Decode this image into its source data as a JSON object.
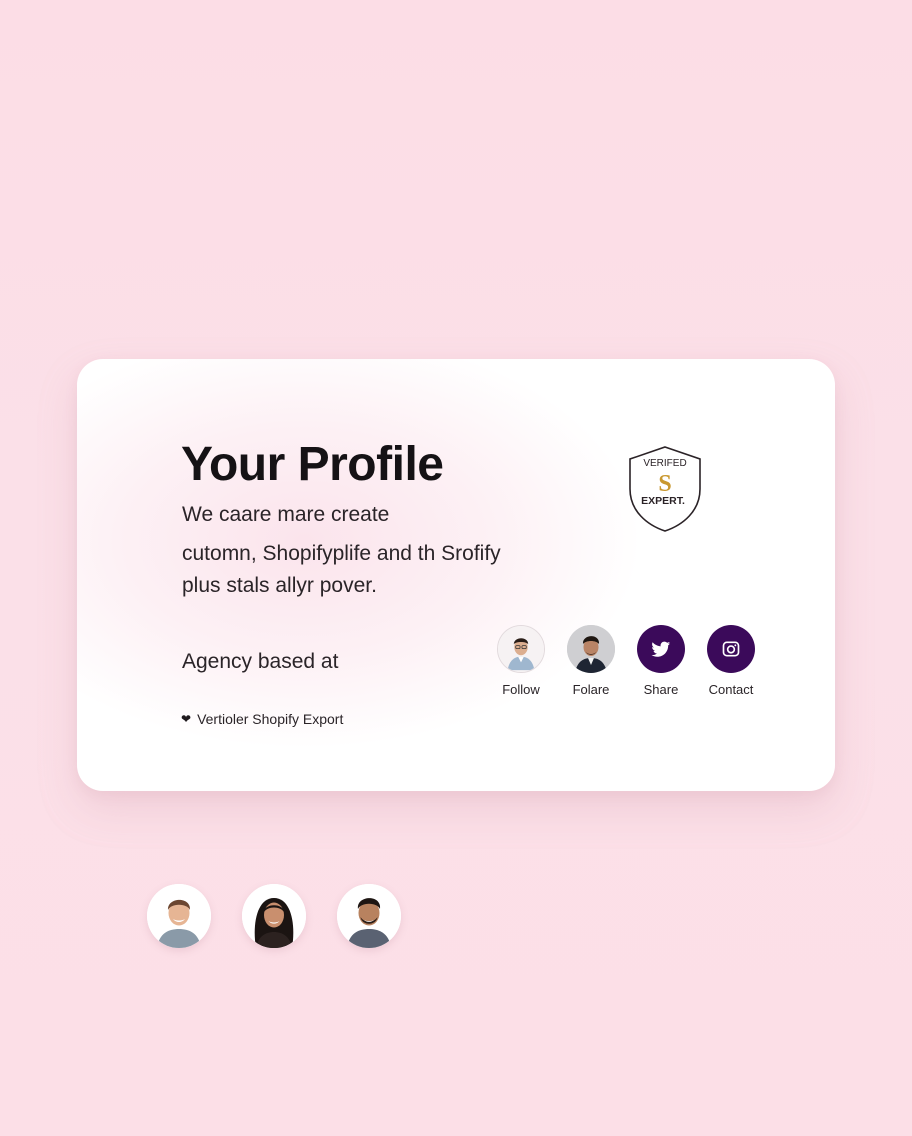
{
  "profile": {
    "title": "Your Profile",
    "description_lines": [
      "We caare mare create",
      "cutomn, Shopifyplife and th Srofify",
      "plus stals allyr pover."
    ],
    "agency_text": "Agency based at",
    "verified_text": "Vertioler Shopify Export"
  },
  "badge": {
    "top_text": "VERIFED",
    "letter": "S",
    "bottom_text": "EXPERT."
  },
  "actions": [
    {
      "label": "Follow",
      "icon": "avatar-icon"
    },
    {
      "label": "Folare",
      "icon": "avatar-icon"
    },
    {
      "label": "Share",
      "icon": "twitter-icon"
    },
    {
      "label": "Contact",
      "icon": "instagram-icon"
    }
  ],
  "colors": {
    "accent": "#3b0a5a",
    "background": "#fcdde6",
    "badge_gold": "#c9982f"
  }
}
